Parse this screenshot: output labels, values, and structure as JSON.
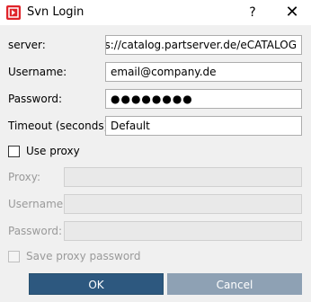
{
  "window": {
    "title": "Svn Login",
    "help_label": "?",
    "close_label": "✕"
  },
  "form": {
    "server_label": "server:",
    "server_value": "https://catalog.partserver.de/eCATALOG",
    "username_label": "Username:",
    "username_value": "email@company.de",
    "password_label": "Password:",
    "password_value": "●●●●●●●●",
    "timeout_label": "Timeout (seconds):",
    "timeout_value": "Default",
    "use_proxy_label": "Use proxy",
    "use_proxy_checked": false
  },
  "proxy": {
    "proxy_label": "Proxy:",
    "proxy_value": "",
    "username_label": "Username:",
    "username_value": "",
    "password_label": "Password:",
    "password_value": "",
    "save_password_label": "Save proxy password",
    "save_password_checked": false
  },
  "buttons": {
    "ok_label": "OK",
    "cancel_label": "Cancel"
  },
  "colors": {
    "app_icon": "#e0242a",
    "ok_button": "#2d587f",
    "cancel_button": "#8ea1b4"
  }
}
